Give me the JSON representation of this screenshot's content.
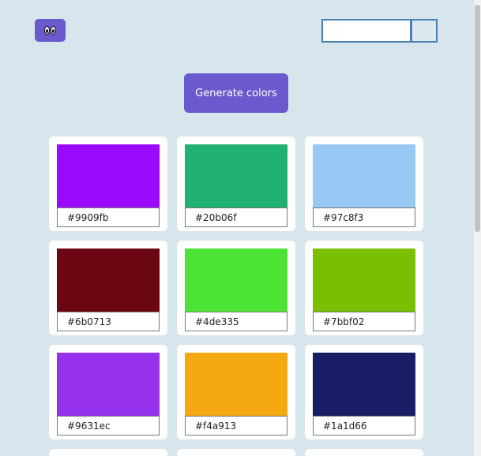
{
  "header": {
    "logo_icon": "eyes-icon",
    "search": {
      "value": "",
      "placeholder": ""
    }
  },
  "main": {
    "generate_label": "Generate colors",
    "palette": [
      {
        "hex": "#9909fb"
      },
      {
        "hex": "#20b06f"
      },
      {
        "hex": "#97c8f3"
      },
      {
        "hex": "#6b0713"
      },
      {
        "hex": "#4de335"
      },
      {
        "hex": "#7bbf02"
      },
      {
        "hex": "#9631ec"
      },
      {
        "hex": "#f4a913"
      },
      {
        "hex": "#1a1d66"
      }
    ]
  },
  "colors": {
    "background": "#d6e6ec",
    "accent": "#6a5acd",
    "search_border": "#4a80b3",
    "card": "#ffffff"
  }
}
